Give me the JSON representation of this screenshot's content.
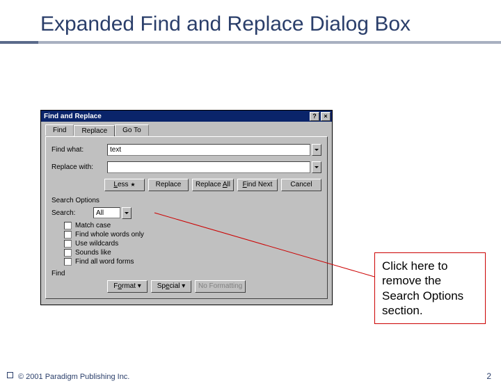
{
  "slide": {
    "title": "Expanded Find and Replace Dialog Box",
    "copyright": "© 2001 Paradigm Publishing Inc.",
    "page": "2"
  },
  "callout": {
    "text": "Click here to remove the Search Options section."
  },
  "dialog": {
    "title": "Find and Replace",
    "tabs": {
      "find": "Find",
      "replace": "Replace",
      "goto": "Go To"
    },
    "labels": {
      "find_what": "Find what:",
      "replace_with": "Replace with:",
      "search_options": "Search Options",
      "search": "Search:",
      "find_section": "Find"
    },
    "find_value": "text",
    "replace_value": "",
    "search_dir": "All",
    "buttons": {
      "less": "Less",
      "replace": "Replace",
      "replace_all": "Replace All",
      "find_next": "Find Next",
      "cancel": "Cancel",
      "format": "Format",
      "special": "Special",
      "no_formatting": "No Formatting"
    },
    "checks": {
      "match_case": "Match case",
      "whole_words": "Find whole words only",
      "wildcards": "Use wildcards",
      "sounds_like": "Sounds like",
      "word_forms": "Find all word forms"
    }
  }
}
